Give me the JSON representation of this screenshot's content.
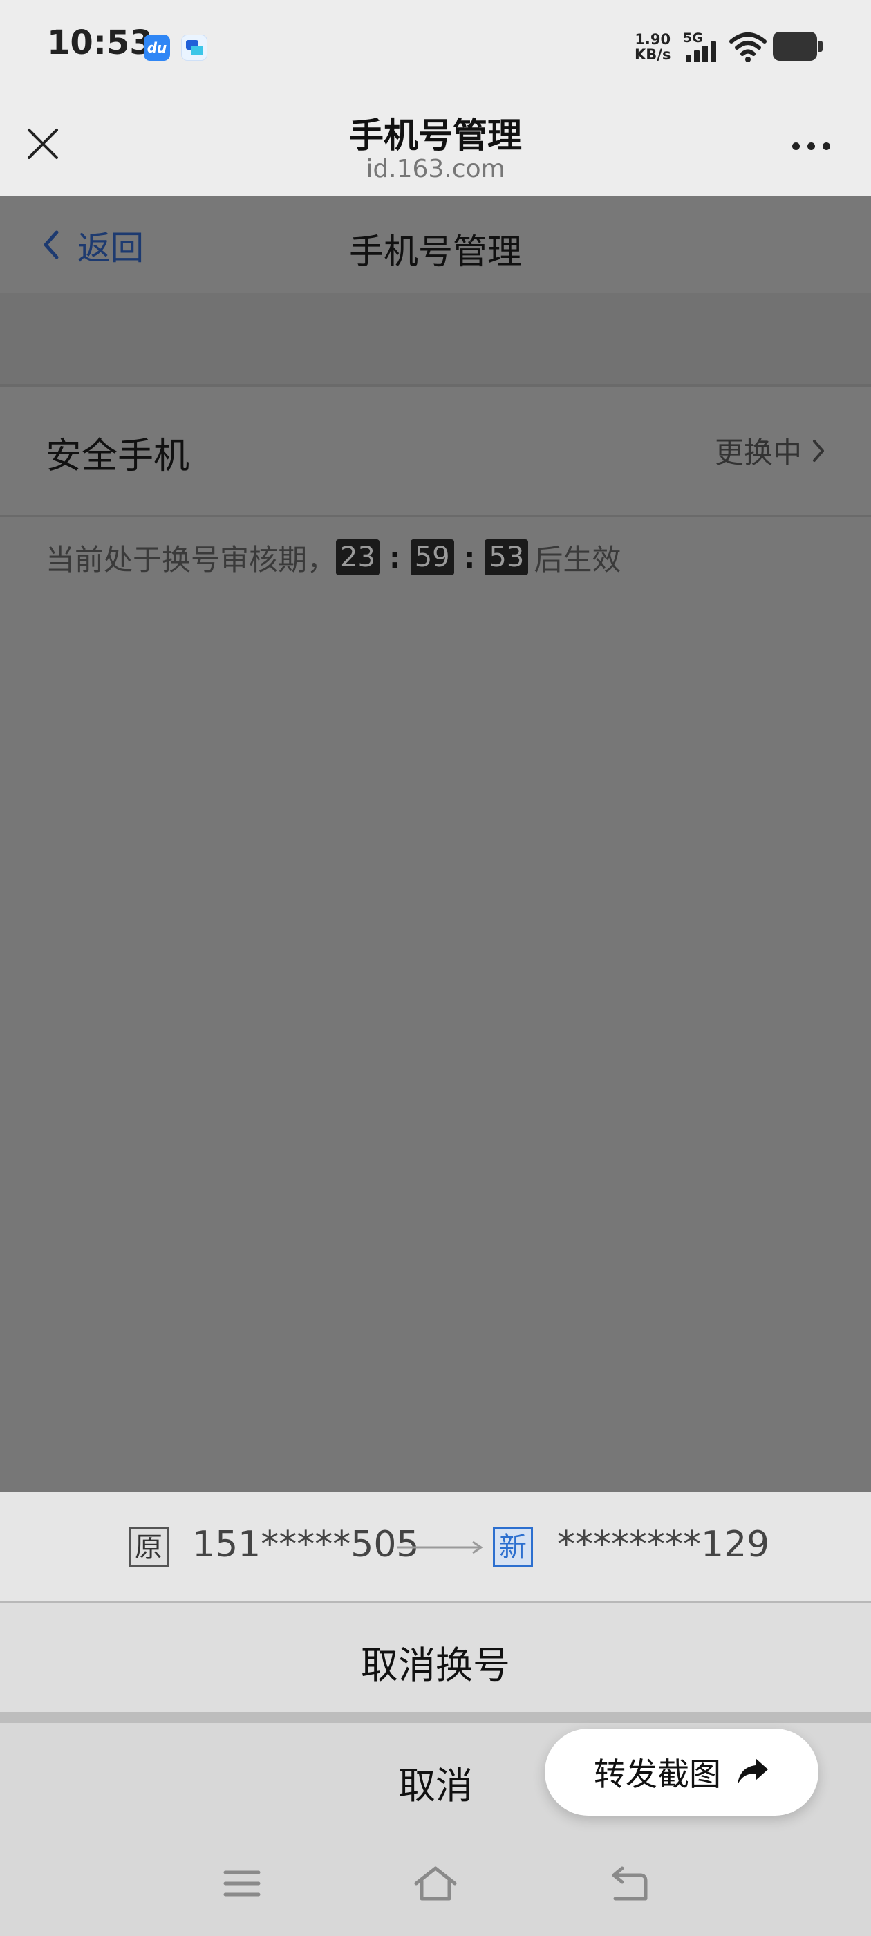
{
  "status_bar": {
    "time": "10:53",
    "speed_value": "1.90",
    "speed_unit": "KB/s",
    "network_type": "5G",
    "app_badge_du": "du",
    "icons": [
      "du-app-icon",
      "message-app-icon",
      "signal-icon",
      "wifi-icon",
      "battery-icon"
    ]
  },
  "browser_header": {
    "title": "手机号管理",
    "url": "id.163.com",
    "icons": [
      "close-icon",
      "more-icon"
    ]
  },
  "page": {
    "back_label": "返回",
    "title": "手机号管理",
    "row": {
      "label": "安全手机",
      "status": "更换中"
    },
    "notice": {
      "prefix": "当前处于换号审核期，",
      "hours": "23",
      "minutes": "59",
      "seconds": "53",
      "separator": ":",
      "suffix": "后生效"
    }
  },
  "sheet": {
    "old_tag": "原",
    "old_number": "151*****505",
    "new_tag": "新",
    "new_number": "********129",
    "cancel_change_label": "取消换号",
    "cancel_label": "取消",
    "forward_label": "转发截图"
  },
  "colors": {
    "accent_blue": "#2c6fcf",
    "back_blue": "#1d3a70",
    "overlay": "#787878"
  }
}
